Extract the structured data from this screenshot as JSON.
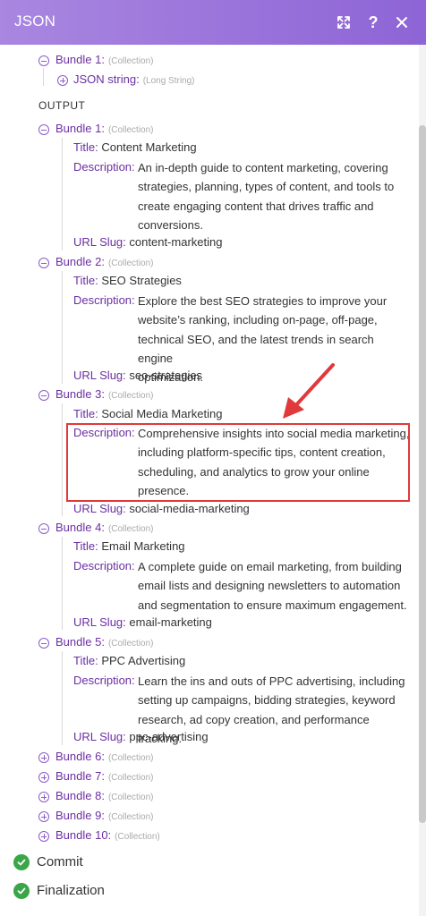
{
  "header": {
    "title": "JSON",
    "help_glyph": "?"
  },
  "input_section": {
    "bundle": {
      "label": "Bundle 1:",
      "type": "(Collection)"
    },
    "json_string": {
      "label": "JSON string:",
      "type": "(Long String)"
    }
  },
  "output_label": "OUTPUT",
  "output_bundles": [
    {
      "label": "Bundle 1:",
      "type": "(Collection)",
      "title_key": "Title:",
      "title": "Content Marketing",
      "desc_key": "Description:",
      "desc_lines": [
        "An in-depth guide to content marketing, covering",
        "strategies, planning, types of content, and tools to",
        "create engaging content that drives traffic and",
        "conversions."
      ],
      "slug_key": "URL Slug:",
      "slug": "content-marketing"
    },
    {
      "label": "Bundle 2:",
      "type": "(Collection)",
      "title_key": "Title:",
      "title": "SEO Strategies",
      "desc_key": "Description:",
      "desc_lines": [
        "Explore the best SEO strategies to improve your",
        "website’s ranking, including on-page, off-page,",
        "technical SEO, and the latest trends in search engine",
        "optimization."
      ],
      "slug_key": "URL Slug:",
      "slug": "seo-strategies"
    },
    {
      "label": "Bundle 3:",
      "type": "(Collection)",
      "title_key": "Title:",
      "title": "Social Media Marketing",
      "desc_key": "Description:",
      "desc_lines": [
        "Comprehensive insights into social media marketing,",
        "including platform-specific tips, content creation,",
        "scheduling, and analytics to grow your online",
        "presence."
      ],
      "slug_key": "URL Slug:",
      "slug": "social-media-marketing"
    },
    {
      "label": "Bundle 4:",
      "type": "(Collection)",
      "title_key": "Title:",
      "title": "Email Marketing",
      "desc_key": "Description:",
      "desc_lines": [
        "A complete guide on email marketing, from building",
        "email lists and designing newsletters to automation",
        "and segmentation to ensure maximum engagement."
      ],
      "slug_key": "URL Slug:",
      "slug": "email-marketing"
    },
    {
      "label": "Bundle 5:",
      "type": "(Collection)",
      "title_key": "Title:",
      "title": "PPC Advertising",
      "desc_key": "Description:",
      "desc_lines": [
        "Learn the ins and outs of PPC advertising, including",
        "setting up campaigns, bidding strategies, keyword",
        "research, ad copy creation, and performance tracking."
      ],
      "slug_key": "URL Slug:",
      "slug": "ppc-advertising"
    }
  ],
  "collapsed_bundles": [
    {
      "label": "Bundle 6:",
      "type": "(Collection)"
    },
    {
      "label": "Bundle 7:",
      "type": "(Collection)"
    },
    {
      "label": "Bundle 8:",
      "type": "(Collection)"
    },
    {
      "label": "Bundle 9:",
      "type": "(Collection)"
    },
    {
      "label": "Bundle 10:",
      "type": "(Collection)"
    }
  ],
  "status": [
    {
      "label": "Commit"
    },
    {
      "label": "Finalization"
    }
  ],
  "colors": {
    "header_start": "#a987e0",
    "header_end": "#8e64d6",
    "key_purple": "#6b2fa3",
    "highlight_red": "#e0393b",
    "success_green": "#3aa649"
  },
  "icons": {
    "expand": "expand-arrows-icon",
    "help": "question-icon",
    "close": "close-icon",
    "collapse": "minus-circle-icon",
    "expand_node": "plus-circle-icon",
    "check": "check-circle-icon"
  }
}
